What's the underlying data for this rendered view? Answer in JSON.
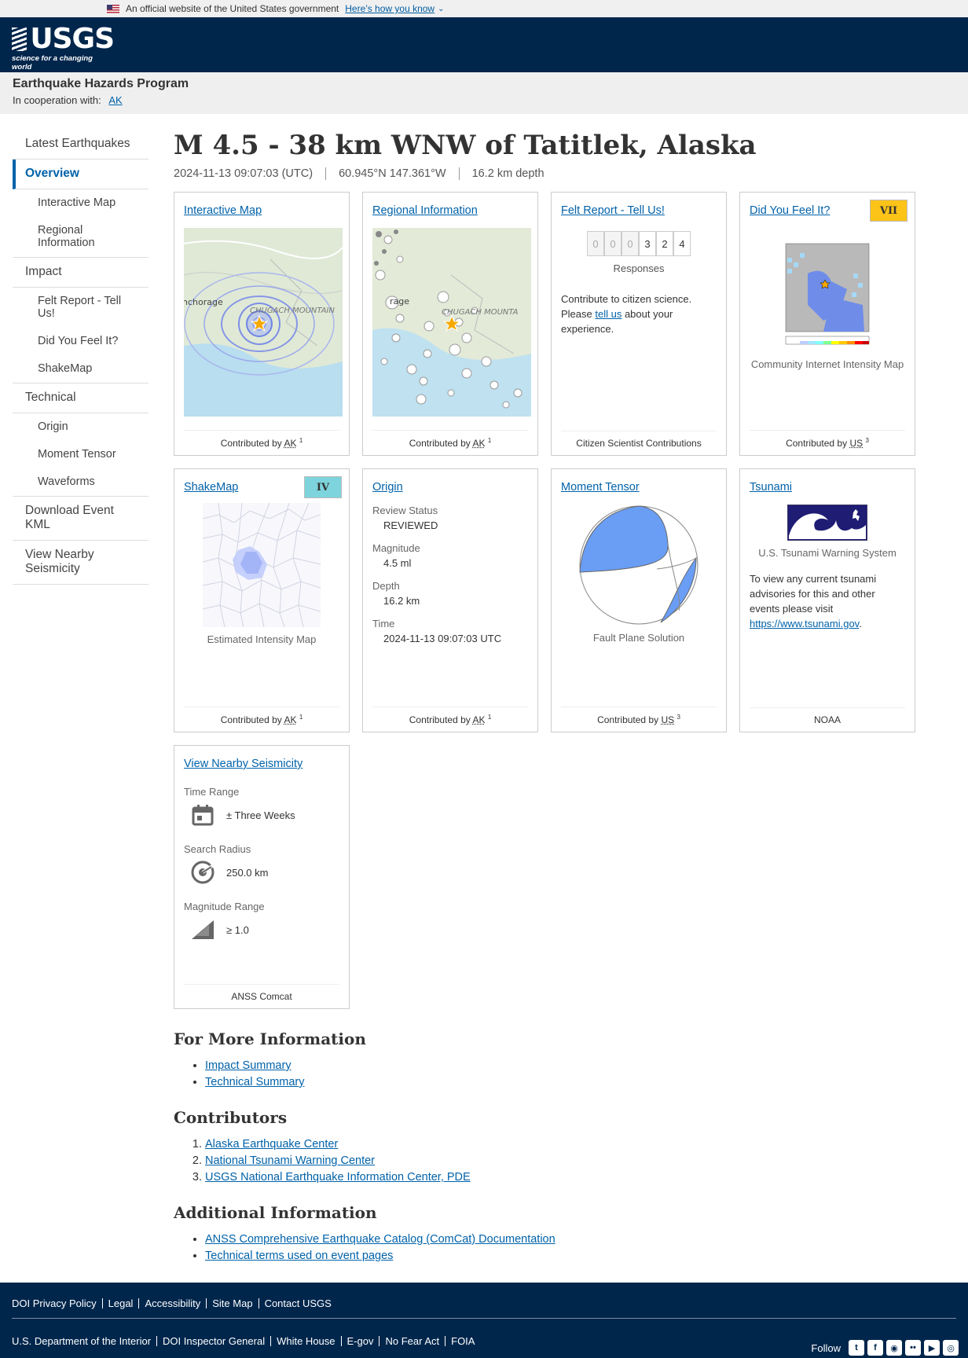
{
  "gov_banner": {
    "text": "An official website of the United States government",
    "link": "Here’s how you know"
  },
  "header": {
    "logo_text": "USGS",
    "logo_tagline": "science for a changing world"
  },
  "program": {
    "title": "Earthquake Hazards Program",
    "coop_label": "In cooperation with:",
    "coop_link": "AK"
  },
  "nav": {
    "latest": "Latest Earthquakes",
    "overview": "Overview",
    "interactive_map": "Interactive Map",
    "regional": "Regional Information",
    "impact": "Impact",
    "felt_report": "Felt Report - Tell Us!",
    "dyfi": "Did You Feel It?",
    "shakemap": "ShakeMap",
    "technical": "Technical",
    "origin": "Origin",
    "moment_tensor": "Moment Tensor",
    "waveforms": "Waveforms",
    "kml": "Download Event KML",
    "nearby": "View Nearby Seismicity"
  },
  "event": {
    "title": "M 4.5 - 38 km WNW of Tatitlek, Alaska",
    "time": "2024-11-13 09:07:03 (UTC)",
    "location": "60.945°N 147.361°W",
    "depth": "16.2 km depth"
  },
  "cards": {
    "interactive_map": {
      "title": "Interactive Map",
      "contrib": "Contributed by",
      "source": "AK",
      "ref": "1",
      "map_label": "nchorage",
      "map_label2": "CHUGACH MOUNTAIN"
    },
    "regional": {
      "title": "Regional Information",
      "contrib": "Contributed by",
      "source": "AK",
      "ref": "1",
      "map_label": "rage",
      "map_label2": "CHUGACH MOUNTA"
    },
    "felt": {
      "title": "Felt Report - Tell Us!",
      "digits": [
        "0",
        "0",
        "0",
        "3",
        "2",
        "4"
      ],
      "responses": "Responses",
      "text1": "Contribute to citizen science. Please ",
      "link": "tell us",
      "text2": " about your experience.",
      "foot": "Citizen Scientist Contributions"
    },
    "dyfi": {
      "title": "Did You Feel It?",
      "badge": "VII",
      "badge_color": "#fcc419",
      "caption": "Community Internet Intensity Map",
      "contrib": "Contributed by",
      "source": "US",
      "ref": "3"
    },
    "shakemap": {
      "title": "ShakeMap",
      "badge": "IV",
      "badge_color": "#7ed4dc",
      "caption": "Estimated Intensity Map",
      "contrib": "Contributed by",
      "source": "AK",
      "ref": "1"
    },
    "origin": {
      "title": "Origin",
      "review_label": "Review Status",
      "review": "REVIEWED",
      "mag_label": "Magnitude",
      "mag": "4.5 ml",
      "depth_label": "Depth",
      "depth": "16.2 km",
      "time_label": "Time",
      "time": "2024-11-13 09:07:03 UTC",
      "contrib": "Contributed by",
      "source": "AK",
      "ref": "1"
    },
    "moment": {
      "title": "Moment Tensor",
      "caption": "Fault Plane Solution",
      "contrib": "Contributed by",
      "source": "US",
      "ref": "3"
    },
    "tsunami": {
      "title": "Tsunami",
      "caption": "U.S. Tsunami Warning System",
      "text": "To view any current tsunami advisories for this and other events please visit ",
      "link": "https://www.tsunami.gov",
      "after": ".",
      "foot": "NOAA"
    },
    "seismicity": {
      "title": "View Nearby Seismicity",
      "time_label": "Time Range",
      "time": "± Three Weeks",
      "radius_label": "Search Radius",
      "radius": "250.0 km",
      "mag_label": "Magnitude Range",
      "mag": "≥ 1.0",
      "foot": "ANSS Comcat"
    }
  },
  "more_info": {
    "title": "For More Information",
    "items": [
      "Impact Summary",
      "Technical Summary"
    ]
  },
  "contributors": {
    "title": "Contributors",
    "items": [
      "Alaska Earthquake Center",
      "National Tsunami Warning Center",
      "USGS National Earthquake Information Center, PDE"
    ]
  },
  "additional": {
    "title": "Additional Information",
    "items": [
      "ANSS Comprehensive Earthquake Catalog (ComCat) Documentation",
      "Technical terms used on event pages"
    ]
  },
  "footer": {
    "row1": [
      "DOI Privacy Policy",
      "Legal",
      "Accessibility",
      "Site Map",
      "Contact USGS"
    ],
    "row2": [
      "U.S. Department of the Interior",
      "DOI Inspector General",
      "White House",
      "E-gov",
      "No Fear Act",
      "FOIA"
    ],
    "follow": "Follow",
    "social_icons": [
      "twitter-icon",
      "facebook-icon",
      "github-icon",
      "flickr-icon",
      "youtube-icon",
      "instagram-icon"
    ]
  }
}
